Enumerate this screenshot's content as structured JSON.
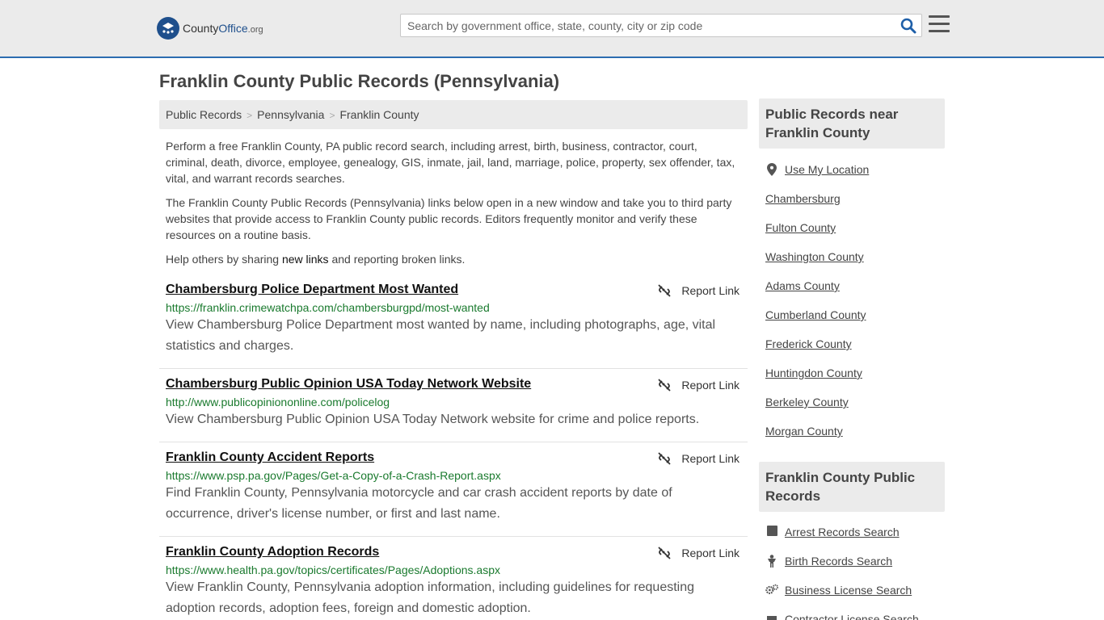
{
  "header": {
    "logo": {
      "county": "County",
      "office": "Office",
      "tld": ".org"
    },
    "search_placeholder": "Search by government office, state, county, city or zip code"
  },
  "page_title": "Franklin County Public Records (Pennsylvania)",
  "breadcrumb": [
    "Public Records",
    "Pennsylvania",
    "Franklin County"
  ],
  "intro": {
    "p1": "Perform a free Franklin County, PA public record search, including arrest, birth, business, contractor, court, criminal, death, divorce, employee, genealogy, GIS, inmate, jail, land, marriage, police, property, sex offender, tax, vital, and warrant records searches.",
    "p2": "The Franklin County Public Records (Pennsylvania) links below open in a new window and take you to third party websites that provide access to Franklin County public records. Editors frequently monitor and verify these resources on a routine basis.",
    "p3_pre": "Help others by sharing ",
    "p3_link": "new links",
    "p3_post": " and reporting broken links."
  },
  "report_label": "Report Link",
  "records": [
    {
      "title": "Chambersburg Police Department Most Wanted",
      "url": "https://franklin.crimewatchpa.com/chambersburgpd/most-wanted",
      "desc": "View Chambersburg Police Department most wanted by name, including photographs, age, vital statistics and charges."
    },
    {
      "title": "Chambersburg Public Opinion USA Today Network Website",
      "url": "http://www.publicopiniononline.com/policelog",
      "desc": "View Chambersburg Public Opinion USA Today Network website for crime and police reports."
    },
    {
      "title": "Franklin County Accident Reports",
      "url": "https://www.psp.pa.gov/Pages/Get-a-Copy-of-a-Crash-Report.aspx",
      "desc": "Find Franklin County, Pennsylvania motorcycle and car crash accident reports by date of occurrence, driver's license number, or first and last name."
    },
    {
      "title": "Franklin County Adoption Records",
      "url": "https://www.health.pa.gov/topics/certificates/Pages/Adoptions.aspx",
      "desc": "View Franklin County, Pennsylvania adoption information, including guidelines for requesting adoption records, adoption fees, foreign and domestic adoption."
    }
  ],
  "sidebar": {
    "nearby_title": "Public Records near Franklin County",
    "nearby": [
      "Use My Location",
      "Chambersburg",
      "Fulton County",
      "Washington County",
      "Adams County",
      "Cumberland County",
      "Frederick County",
      "Huntingdon County",
      "Berkeley County",
      "Morgan County"
    ],
    "records_title": "Franklin County Public Records",
    "records_links": [
      "Arrest Records Search",
      "Birth Records Search",
      "Business License Search",
      "Contractor License Search"
    ]
  }
}
